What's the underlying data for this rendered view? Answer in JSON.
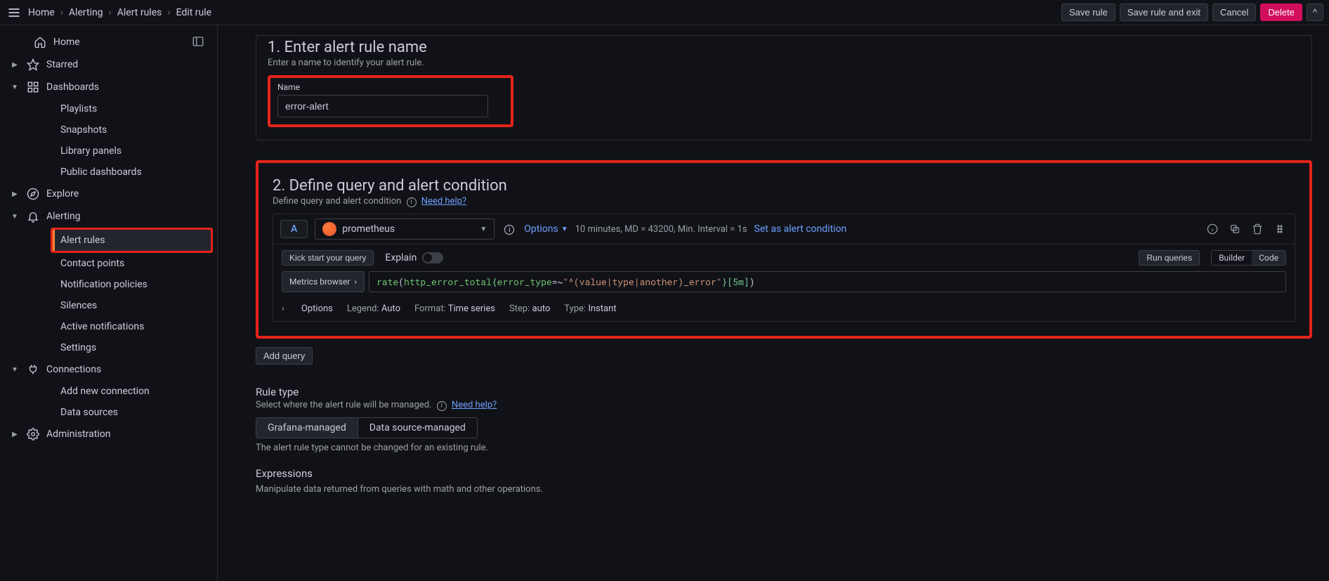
{
  "breadcrumb": {
    "home": "Home",
    "alerting": "Alerting",
    "alert_rules": "Alert rules",
    "edit_rule": "Edit rule"
  },
  "topbar": {
    "save_rule": "Save rule",
    "save_exit": "Save rule and exit",
    "cancel": "Cancel",
    "delete": "Delete"
  },
  "sidebar": {
    "home": "Home",
    "starred": "Starred",
    "dashboards": "Dashboards",
    "playlists": "Playlists",
    "snapshots": "Snapshots",
    "library_panels": "Library panels",
    "public_dashboards": "Public dashboards",
    "explore": "Explore",
    "alerting": "Alerting",
    "alert_rules": "Alert rules",
    "contact_points": "Contact points",
    "notification_policies": "Notification policies",
    "silences": "Silences",
    "active_notifications": "Active notifications",
    "settings": "Settings",
    "connections": "Connections",
    "add_new_connection": "Add new connection",
    "data_sources": "Data sources",
    "administration": "Administration"
  },
  "section1": {
    "title": "1. Enter alert rule name",
    "subtitle": "Enter a name to identify your alert rule.",
    "name_label": "Name",
    "name_value": "error-alert"
  },
  "section2": {
    "title": "2. Define query and alert condition",
    "subtitle": "Define query and alert condition",
    "need_help": "Need help?",
    "query_letter": "A",
    "datasource": "prometheus",
    "options_label": "Options",
    "header_meta": "10 minutes, MD = 43200, Min. Interval = 1s",
    "set_as_condition": "Set as alert condition",
    "kick_start": "Kick start your query",
    "explain": "Explain",
    "run_queries": "Run queries",
    "builder": "Builder",
    "code": "Code",
    "metrics_browser": "Metrics browser",
    "query_fn": "rate",
    "query_metric": "http_error_total",
    "query_label": "error_type",
    "query_op": "=~",
    "query_regex": "\"^(value|type|another)_error\"",
    "query_range": "[5m]",
    "opts": {
      "options": "Options",
      "legend_k": "Legend:",
      "legend_v": "Auto",
      "format_k": "Format:",
      "format_v": "Time series",
      "step_k": "Step:",
      "step_v": "auto",
      "type_k": "Type:",
      "type_v": "Instant"
    },
    "add_query": "Add query"
  },
  "rule_type": {
    "title": "Rule type",
    "subtitle": "Select where the alert rule will be managed.",
    "need_help": "Need help?",
    "grafana": "Grafana-managed",
    "datasource": "Data source-managed",
    "note": "The alert rule type cannot be changed for an existing rule."
  },
  "expressions": {
    "title": "Expressions",
    "subtitle": "Manipulate data returned from queries with math and other operations."
  }
}
